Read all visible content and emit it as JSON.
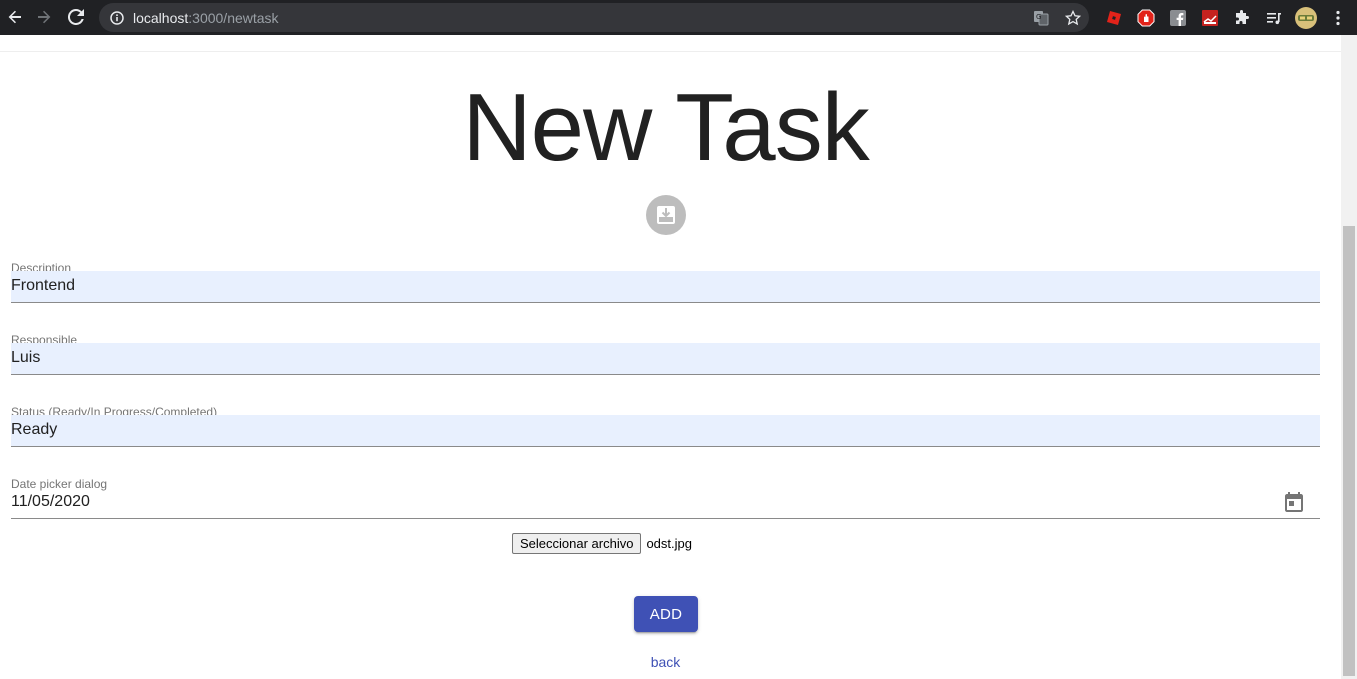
{
  "browser": {
    "url_host": "localhost",
    "url_path": ":3000/newtask",
    "icons": {
      "back": "arrow-left-icon",
      "forward": "arrow-right-icon",
      "reload": "reload-icon",
      "info": "info-icon",
      "translate": "translate-icon",
      "bookmark": "star-icon",
      "extensions": [
        "roblox-extension-icon",
        "adblock-extension-icon",
        "facebook-extension-icon",
        "chart-extension-icon",
        "puzzle-icon",
        "media-queue-icon",
        "profile-avatar-icon",
        "more-menu-icon"
      ]
    }
  },
  "page": {
    "title": "New Task",
    "upload_icon": "upload-image-icon"
  },
  "form": {
    "description": {
      "label": "Description",
      "value": "Frontend"
    },
    "responsible": {
      "label": "Responsible",
      "value": "Luis"
    },
    "status": {
      "label": "Status (Ready/In Progress/Completed)",
      "value": "Ready"
    },
    "date": {
      "label": "Date picker dialog",
      "value": "11/05/2020",
      "icon": "calendar-icon"
    },
    "file": {
      "button_label": "Seleccionar archivo",
      "file_name": "odst.jpg"
    },
    "submit_label": "ADD",
    "back_label": "back"
  },
  "colors": {
    "primary": "#3f51b5",
    "autofill": "#e8f0fe",
    "chrome_bg": "#202124"
  }
}
